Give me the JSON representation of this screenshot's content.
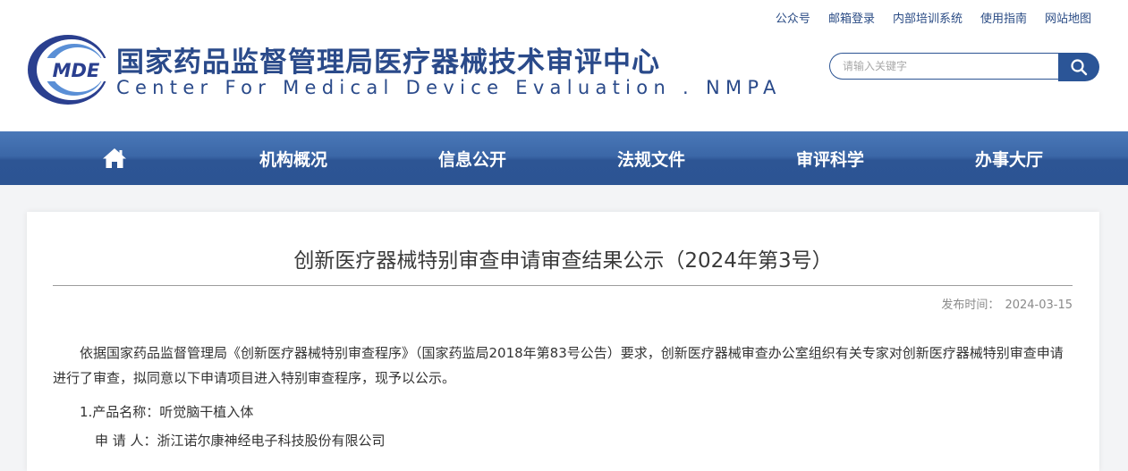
{
  "top_links": [
    "公众号",
    "邮箱登录",
    "内部培训系统",
    "使用指南",
    "网站地图"
  ],
  "logo": {
    "text": "MDE",
    "colors": {
      "ring_dark": "#2a3f8f",
      "ring_light": "#5a8fd6"
    }
  },
  "site": {
    "title_cn": "国家药品监督管理局医疗器械技术审评中心",
    "title_en": "Center For Medical Device Evaluation . NMPA"
  },
  "search": {
    "placeholder": "请输入关键字",
    "value": "",
    "icon": "search-icon"
  },
  "nav": {
    "home_icon": "home-icon",
    "items": [
      "机构概况",
      "信息公开",
      "法规文件",
      "审评科学",
      "办事大厅"
    ]
  },
  "article": {
    "title": "创新医疗器械特别审查申请审查结果公示（2024年第3号）",
    "publish_label": "发布时间：",
    "publish_date": "2024-03-15",
    "intro": "依据国家药品监督管理局《创新医疗器械特别审查程序》（国家药监局2018年第83号公告）要求，创新医疗器械审查办公室组织有关专家对创新医疗器械特别审查申请进行了审查，拟同意以下申请项目进入特别审查程序，现予以公示。",
    "items": [
      {
        "product_line": "1.产品名称：听觉脑干植入体",
        "applicant_line": "申 请 人：浙江诺尔康神经电子科技股份有限公司"
      }
    ]
  },
  "colors": {
    "brand_blue": "#2a4a8a",
    "nav_blue": "#2c5493",
    "page_bg": "#f3f4f6"
  }
}
